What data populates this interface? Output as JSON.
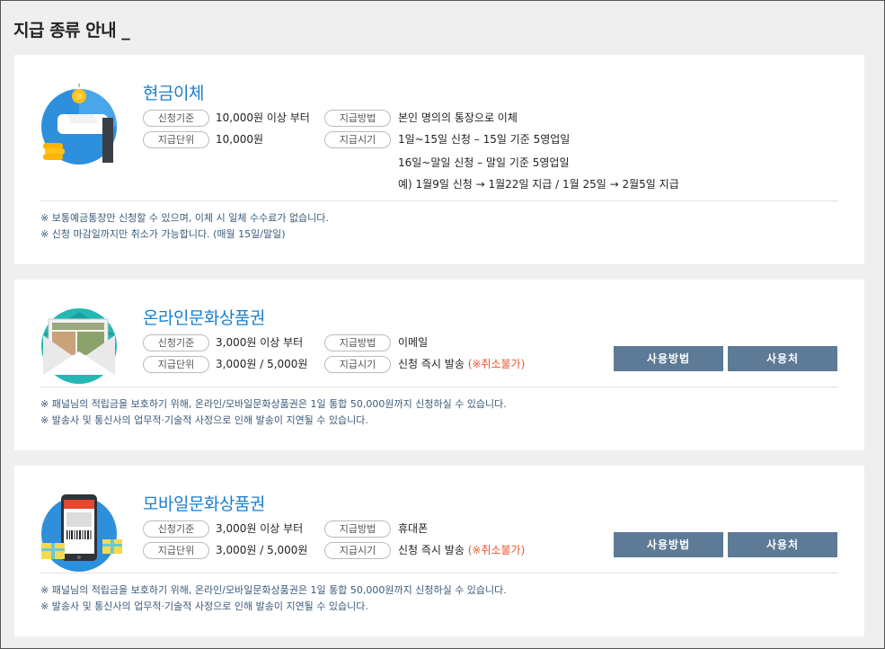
{
  "page_title": "지급 종류 안내 _",
  "cards": [
    {
      "title": "현금이체",
      "rows": [
        {
          "label_a": "신청기준",
          "value_a": "10,000원 이상 부터",
          "label_b": "지급방법",
          "value_b": "본인 명의의 통장으로 이체"
        },
        {
          "label_a": "지급단위",
          "value_a": "10,000원",
          "label_b": "지급시기",
          "value_b": "1일~15일 신청 – 15일 기준 5영업일"
        }
      ],
      "extra_lines": [
        "16일~말일 신청 – 말일 기준 5영업일"
      ],
      "example": "예) 1월9일 신청 → 1월22일 지급 / 1월 25일 → 2월5일 지급",
      "notes": [
        "※ 보통예금통장만 신청할 수 있으며, 이체 시 일체 수수료가 없습니다.",
        "※ 신청 마감일까지만 취소가 가능합니다. (매월 15일/말일)"
      ]
    },
    {
      "title": "온라인문화상품권",
      "rows": [
        {
          "label_a": "신청기준",
          "value_a": "3,000원 이상 부터",
          "label_b": "지급방법",
          "value_b": "이메일"
        },
        {
          "label_a": "지급단위",
          "value_a": "3,000원 / 5,000원",
          "label_b": "지급시기",
          "value_b": "신청 즉시 발송",
          "value_b_red": "(※취소불가)"
        }
      ],
      "buttons": {
        "use": "사용방법",
        "place": "사용처"
      },
      "notes": [
        "※ 패널님의 적립금을 보호하기 위해, 온라인/모바일문화상품권은 1일 통합 50,000원까지 신청하실 수 있습니다.",
        "※ 발송사 및 통신사의 업무적·기술적 사정으로 인해 발송이 지연될 수 있습니다."
      ]
    },
    {
      "title": "모바일문화상품권",
      "rows": [
        {
          "label_a": "신청기준",
          "value_a": "3,000원 이상 부터",
          "label_b": "지급방법",
          "value_b": "휴대폰"
        },
        {
          "label_a": "지급단위",
          "value_a": "3,000원 / 5,000원",
          "label_b": "지급시기",
          "value_b": "신청 즉시 발송",
          "value_b_red": "(※취소불가)"
        }
      ],
      "buttons": {
        "use": "사용방법",
        "place": "사용처"
      },
      "notes": [
        "※ 패널님의 적립금을 보호하기 위해, 온라인/모바일문화상품권은 1일 통합 50,000원까지 신청하실 수 있습니다.",
        "※ 발송사 및 통신사의 업무적·기술적 사정으로 인해 발송이 지연될 수 있습니다."
      ]
    }
  ],
  "icons": [
    "cash-transfer-icon",
    "envelope-voucher-icon",
    "mobile-voucher-icon"
  ],
  "colors": {
    "title_blue": "#1a7fd0",
    "button_bg": "#5d7a96",
    "warning_red": "#e8552c",
    "note_text": "#3a5a7a"
  }
}
